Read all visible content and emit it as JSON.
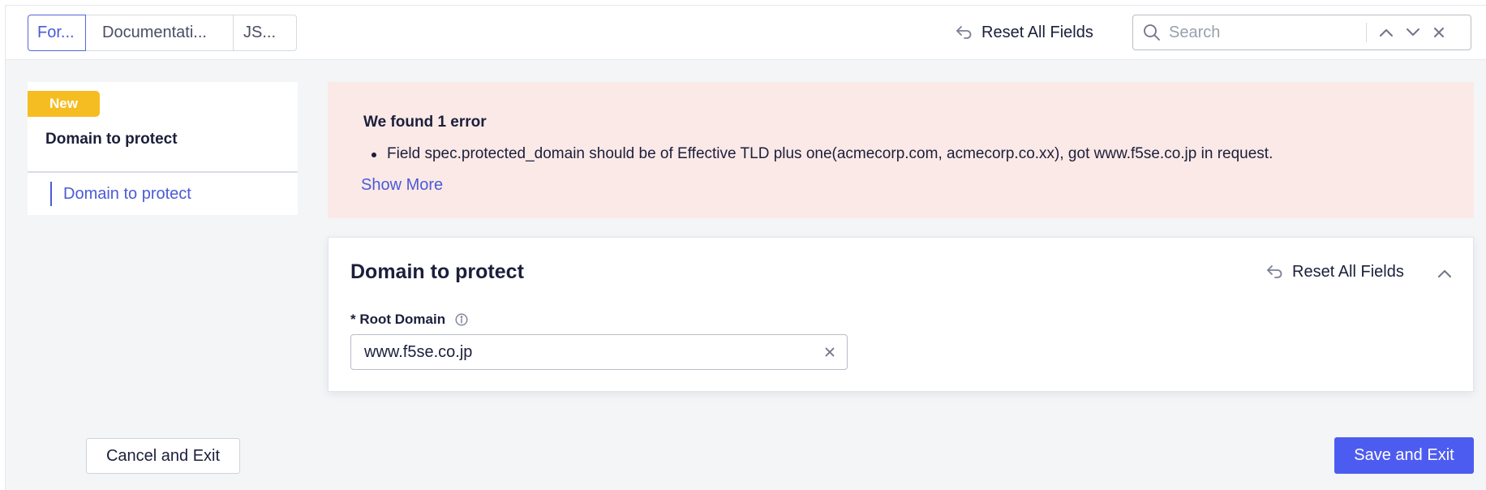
{
  "tabs": [
    {
      "label": "For..."
    },
    {
      "label": "Documentati..."
    },
    {
      "label": "JS..."
    }
  ],
  "toolbar": {
    "reset_label": "Reset All Fields",
    "search_placeholder": "Search"
  },
  "sidebar": {
    "badge": "New",
    "title": "Domain to protect",
    "items": [
      {
        "label": "Domain to protect"
      }
    ]
  },
  "error_banner": {
    "title": "We found 1 error",
    "message": "Field spec.protected_domain should be of Effective TLD plus one(acmecorp.com, acmecorp.co.xx), got www.f5se.co.jp in request.",
    "show_more": "Show More"
  },
  "section": {
    "title": "Domain to protect",
    "reset_label": "Reset All Fields",
    "field": {
      "label": "* Root Domain",
      "value": "www.f5se.co.jp"
    }
  },
  "footer": {
    "cancel_label": "Cancel and Exit",
    "save_label": "Save and Exit"
  },
  "colors": {
    "accent": "#4b5bd6",
    "primary_button": "#4d5cf0",
    "badge": "#f6bd22",
    "error_bg": "#fbe9e7"
  }
}
